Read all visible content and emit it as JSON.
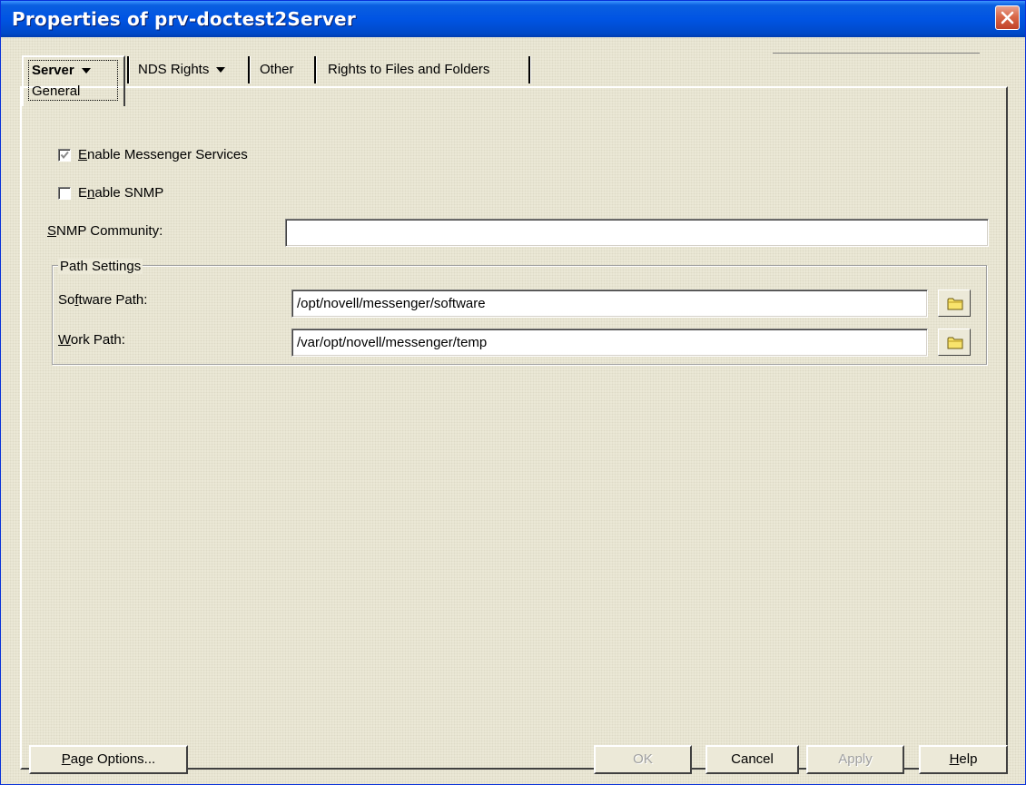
{
  "window": {
    "title": "Properties of prv-doctest2Server"
  },
  "tabs": {
    "server": {
      "label": "Server",
      "sub_label": "General"
    },
    "nds_rights": {
      "label": "NDS Rights"
    },
    "other": {
      "label": "Other"
    },
    "rights_files": {
      "label": "Rights to Files and Folders"
    }
  },
  "form": {
    "enable_messenger": {
      "label_accel": "E",
      "label_rest": "nable Messenger Services",
      "checked": true
    },
    "enable_snmp": {
      "label_pre": "E",
      "label_accel": "n",
      "label_rest": "able SNMP",
      "checked": false
    },
    "snmp_community": {
      "label_accel": "S",
      "label_rest": "NMP Community:",
      "value": ""
    },
    "path_settings": {
      "title": "Path Settings",
      "software_path": {
        "label_pre": "So",
        "label_accel": "f",
        "label_rest": "tware Path:",
        "value": "/opt/novell/messenger/software"
      },
      "work_path": {
        "label_accel": "W",
        "label_rest": "ork Path:",
        "value": "/var/opt/novell/messenger/temp"
      }
    }
  },
  "buttons": {
    "page_options": {
      "accel": "P",
      "rest": "age Options..."
    },
    "ok": "OK",
    "cancel": "Cancel",
    "apply": "Apply",
    "help": {
      "accel": "H",
      "rest": "elp"
    }
  }
}
